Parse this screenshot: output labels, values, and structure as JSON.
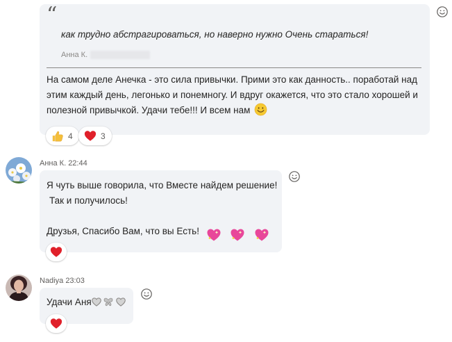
{
  "messages": [
    {
      "quote": {
        "text": "как трудно абстрагироваться, но наверно нужно Очень стараться!",
        "author": "Анна К."
      },
      "body_lines": [
        "На самом деле Анечка - это сила привычки. Прими это как данность.. поработай над",
        "этим каждый день, легонько и понемногу. И вдруг окажется, что это стало хорошей и",
        "полезной привычкой. Удачи тебе!!! И всем нам"
      ],
      "reactions": [
        {
          "icon": "thumbs-up-icon",
          "count": "4"
        },
        {
          "icon": "heart-icon",
          "count": "3"
        }
      ]
    },
    {
      "sender": "Анна К.",
      "time": "22:44",
      "lines": [
        "Я чуть выше говорила, что Вместе найдем решение!",
        "Так и получилось!",
        "Друзья, Спасибо Вам, что вы Есть!"
      ]
    },
    {
      "sender": "Nadiya",
      "time": "23:03",
      "text": "Удачи Аня"
    }
  ],
  "colors": {
    "bubble": "#f1f3f6",
    "heart": "#e0202a",
    "sparkle_heart": "#e8479a",
    "thumb": "#f4bf3a",
    "meta": "#605e5c"
  }
}
